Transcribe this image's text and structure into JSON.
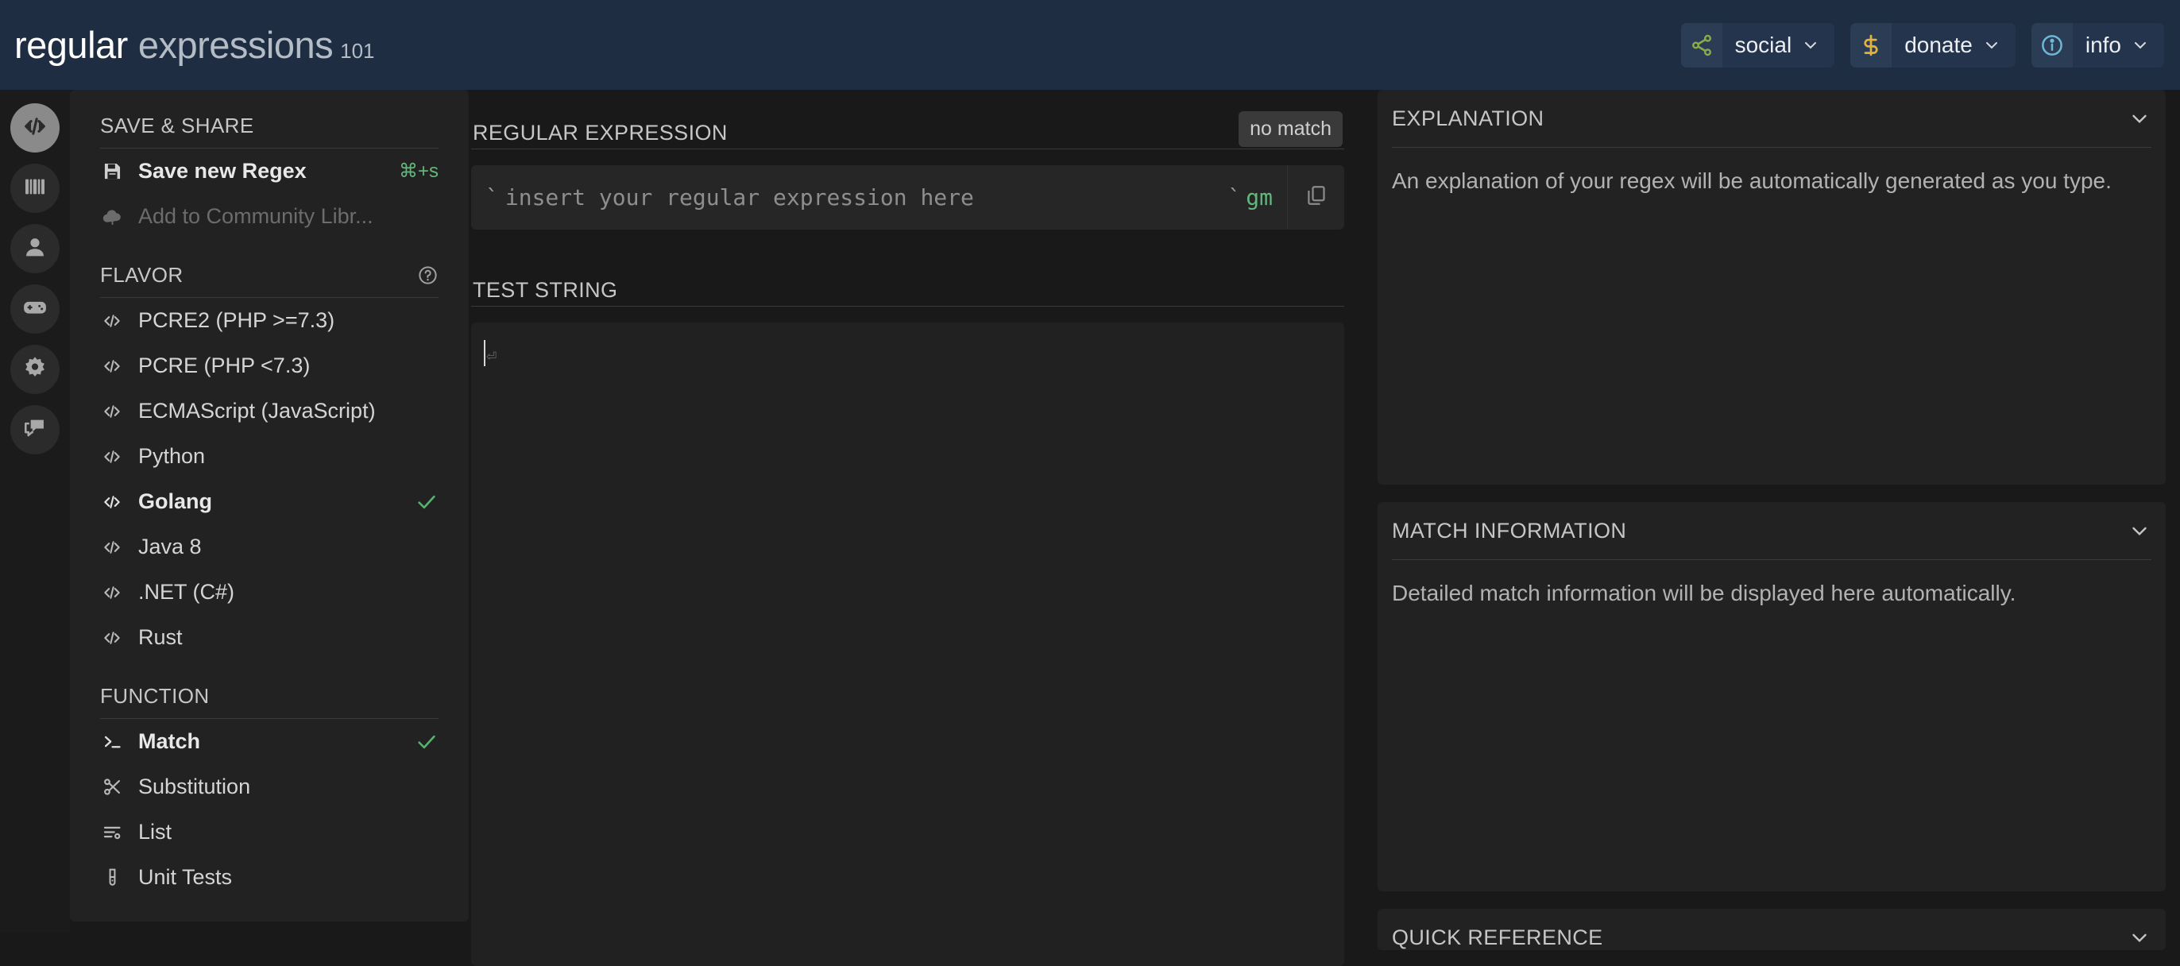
{
  "header": {
    "brand_primary": "regular",
    "brand_secondary": "expressions",
    "brand_suffix": "101",
    "nav": [
      {
        "label": "social",
        "icon": "share-nodes-icon",
        "caret": "chevron-down-icon"
      },
      {
        "label": "donate",
        "icon": "dollar-sign-icon",
        "caret": "chevron-down-icon"
      },
      {
        "label": "info",
        "icon": "info-circle-icon",
        "caret": "chevron-down-icon"
      }
    ]
  },
  "rail": {
    "items": [
      {
        "name": "code-icon",
        "label": "Editor",
        "active": true
      },
      {
        "name": "library-icon",
        "label": "Library",
        "active": false
      },
      {
        "name": "account-icon",
        "label": "Account",
        "active": false
      },
      {
        "name": "gamepad-icon",
        "label": "Regex Quiz",
        "active": false
      },
      {
        "name": "gear-icon",
        "label": "Settings",
        "active": false
      },
      {
        "name": "chat-icon",
        "label": "Feedback",
        "active": false
      }
    ]
  },
  "sidebar": {
    "save_share": {
      "title": "SAVE & SHARE",
      "items": [
        {
          "label": "Save new Regex",
          "shortcut": "⌘+s",
          "icon": "save-icon",
          "bold": true,
          "dim": false
        },
        {
          "label": "Add to Community Libr...",
          "shortcut": "",
          "icon": "cloud-upload-icon",
          "bold": false,
          "dim": true
        }
      ]
    },
    "flavor": {
      "title": "FLAVOR",
      "help_icon": "help-circle-icon",
      "items": [
        {
          "label": "PCRE2 (PHP >=7.3)",
          "selected": false
        },
        {
          "label": "PCRE (PHP <7.3)",
          "selected": false
        },
        {
          "label": "ECMAScript (JavaScript)",
          "selected": false
        },
        {
          "label": "Python",
          "selected": false
        },
        {
          "label": "Golang",
          "selected": true
        },
        {
          "label": "Java 8",
          "selected": false
        },
        {
          "label": ".NET (C#)",
          "selected": false
        },
        {
          "label": "Rust",
          "selected": false
        }
      ]
    },
    "function": {
      "title": "FUNCTION",
      "items": [
        {
          "label": "Match",
          "icon": "terminal-icon",
          "selected": true
        },
        {
          "label": "Substitution",
          "icon": "scissors-icon",
          "selected": false
        },
        {
          "label": "List",
          "icon": "list-settings-icon",
          "selected": false
        },
        {
          "label": "Unit Tests",
          "icon": "test-tube-icon",
          "selected": false
        }
      ]
    }
  },
  "main": {
    "regex_section": {
      "title": "REGULAR EXPRESSION",
      "match_badge": "no match",
      "open_delimiter": "`",
      "close_delimiter": "`",
      "placeholder": "insert your regular expression here",
      "value": "",
      "flags": "gm",
      "copy_icon": "copy-icon"
    },
    "test_section": {
      "title": "TEST STRING",
      "value": "",
      "newline_mark": "⏎"
    }
  },
  "right": {
    "panels": [
      {
        "title": "EXPLANATION",
        "body": "An explanation of your regex will be automatically generated as you type.",
        "caret": "chevron-down-icon"
      },
      {
        "title": "MATCH INFORMATION",
        "body": "Detailed match information will be displayed here automatically.",
        "caret": "chevron-down-icon"
      },
      {
        "title": "QUICK REFERENCE",
        "body": "",
        "caret": "chevron-down-icon"
      }
    ]
  },
  "colors": {
    "header_bg": "#1e2d42",
    "page_bg": "#191919",
    "panel_bg": "#222222",
    "accent_green": "#59b06f",
    "flag_green": "#63b77c",
    "donate_yellow": "#e3b23c",
    "social_green": "#8aab4a",
    "info_blue": "#6fb7d6"
  }
}
